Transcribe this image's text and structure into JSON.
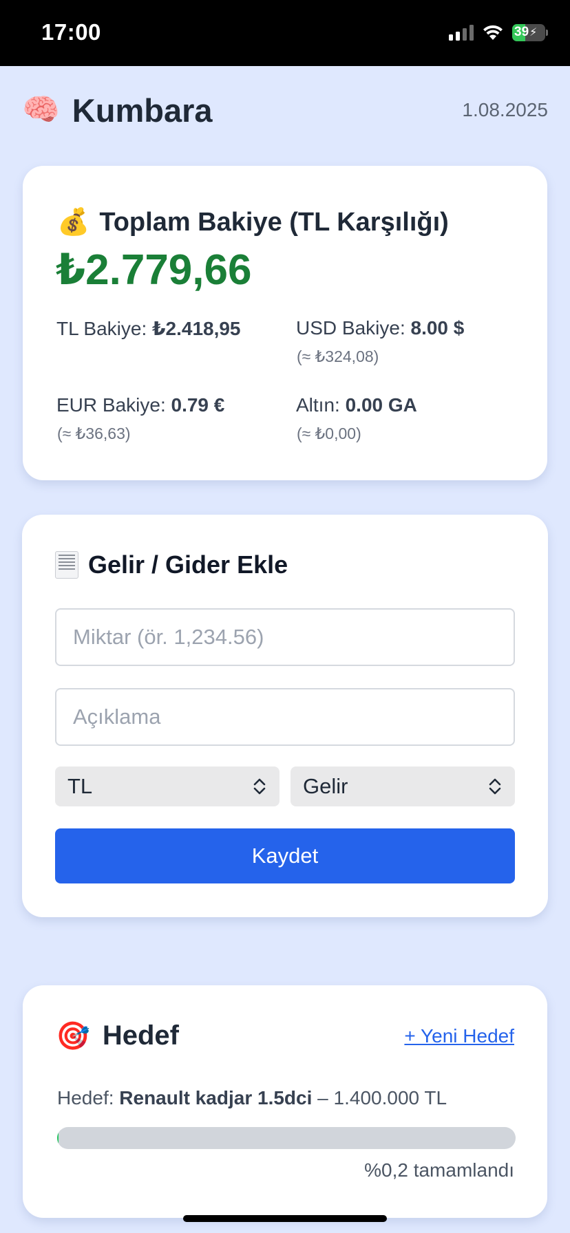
{
  "status_bar": {
    "time": "17:00",
    "battery": "39",
    "battery_level": 0.39,
    "battery_color": "#34c759",
    "signal_bars": 2,
    "icons": [
      "signal-icon",
      "wifi-icon",
      "battery-charging-icon"
    ]
  },
  "header": {
    "icon": "🧠",
    "title": "Kumbara",
    "date": "1.08.2025"
  },
  "balance": {
    "icon": "💰",
    "title": "Toplam Bakiye (TL Karşılığı)",
    "total": "₺2.779,66",
    "total_color": "#1a7f37",
    "items": [
      {
        "label": "TL Bakiye:",
        "value": "₺2.418,95",
        "sub": ""
      },
      {
        "label": "USD Bakiye:",
        "value": "8.00 $",
        "sub": "(≈ ₺324,08)"
      },
      {
        "label": "EUR Bakiye:",
        "value": "0.79 €",
        "sub": "(≈ ₺36,63)"
      },
      {
        "label": "Altın:",
        "value": "0.00 GA",
        "sub": "(≈ ₺0,00)"
      }
    ]
  },
  "entry": {
    "icon_name": "receipt-icon",
    "title": "Gelir / Gider Ekle",
    "amount_placeholder": "Miktar (ör. 1,234.56)",
    "amount_value": "",
    "description_placeholder": "Açıklama",
    "description_value": "",
    "currency_selected": "TL",
    "type_selected": "Gelir",
    "save_label": "Kaydet",
    "accent": "#2563eb"
  },
  "goal": {
    "icon": "🎯",
    "title": "Hedef",
    "new_goal_link": "+ Yeni Hedef",
    "label": "Hedef:",
    "name": "Renault kadjar 1.5dci",
    "amount": "– 1.400.000 TL",
    "progress_percent": 0.2,
    "progress_text": "%0,2 tamamlandı",
    "progress_color": "#22c55e"
  }
}
